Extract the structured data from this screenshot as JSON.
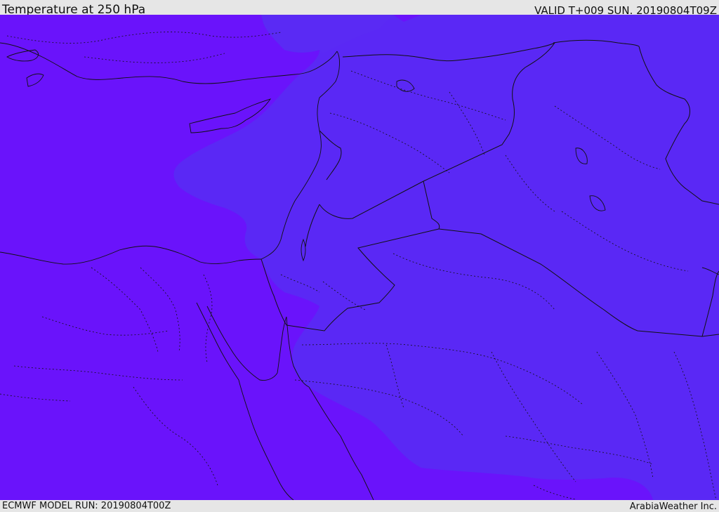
{
  "header": {
    "title": "Temperature at 250 hPa",
    "valid": "VALID T+009 SUN. 20190804T09Z"
  },
  "footer": {
    "model_run": "ECMWF MODEL RUN: 20190804T00Z",
    "credit": "ArabiaWeather Inc."
  },
  "colors": {
    "field_purple": "#6a13fb",
    "field_blue_violet": "#5a28f5",
    "border": "#111111",
    "background": "#e6e6e6"
  }
}
